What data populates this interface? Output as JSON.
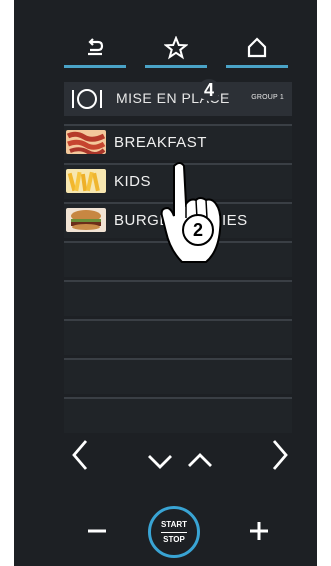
{
  "topbar": {
    "icons": [
      "back-arrow-icon",
      "star-icon",
      "home-icon"
    ],
    "accent": "#4aa3c7"
  },
  "header": {
    "title": "MISE EN PLACE",
    "group": "GROUP 1",
    "icon": "plate-cutlery-icon"
  },
  "callouts": {
    "step4": "4",
    "step2": "2"
  },
  "menu": {
    "items": [
      {
        "label": "BREAKFAST",
        "icon": "bacon-thumbnail"
      },
      {
        "label": "KIDS",
        "icon": "fries-thumbnail"
      },
      {
        "label": "BURGER & FRIES",
        "icon": "burger-thumbnail"
      }
    ]
  },
  "nav": {
    "left": "<",
    "down": "⌄",
    "up": "⌃",
    "right": ">"
  },
  "bottom": {
    "minus": "−",
    "start": "START",
    "stop": "STOP",
    "plus": "+"
  }
}
